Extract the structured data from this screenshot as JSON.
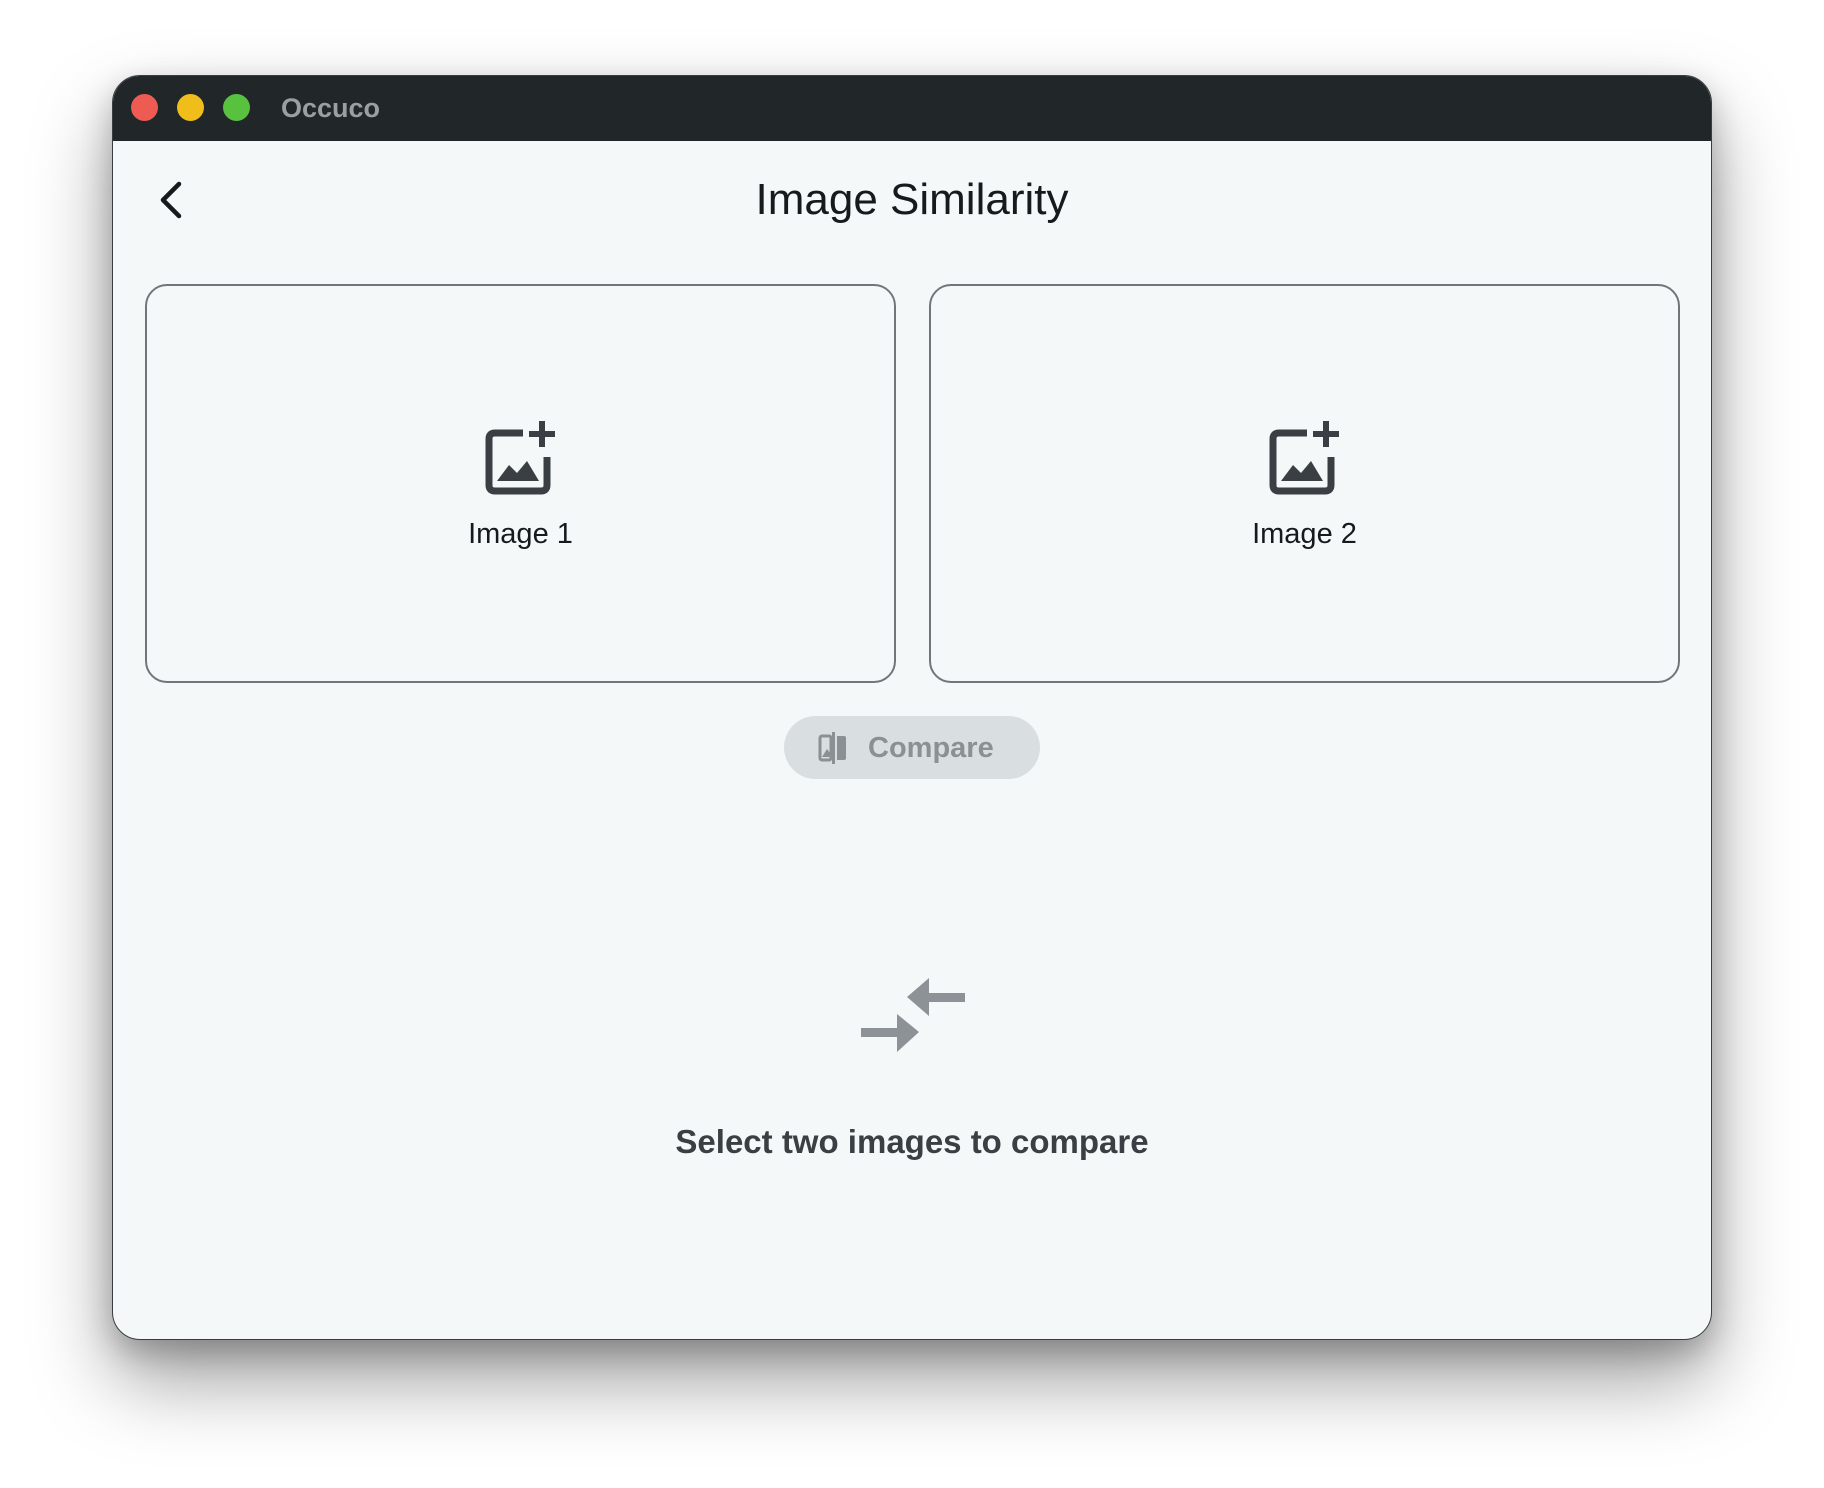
{
  "window": {
    "app_title": "Occuco"
  },
  "header": {
    "title": "Image Similarity",
    "back_icon": "chevron-left-icon"
  },
  "drop_zones": [
    {
      "label": "Image 1",
      "icon": "add-photo-icon"
    },
    {
      "label": "Image 2",
      "icon": "add-photo-icon"
    }
  ],
  "compare": {
    "label": "Compare",
    "icon": "compare-icon",
    "enabled": false
  },
  "empty_state": {
    "icon": "compare-arrows-icon",
    "message": "Select two images to compare"
  },
  "colors": {
    "titlebar": "#212629",
    "background": "#f4f8f9",
    "traffic_red": "#ee5b52",
    "traffic_yellow": "#f1bd1a",
    "traffic_green": "#58c13e",
    "disabled_button": "#d9dfe0",
    "disabled_text": "#8a9094"
  }
}
